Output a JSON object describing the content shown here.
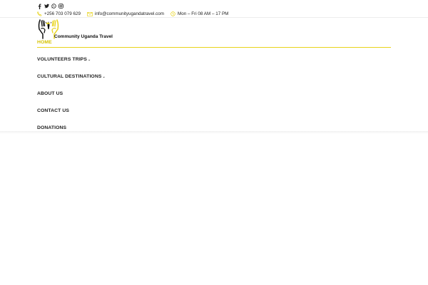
{
  "topbar": {
    "social": [
      "facebook-icon",
      "twitter-icon",
      "whatsapp-icon",
      "instagram-icon"
    ],
    "phone": "+256 703 079 629",
    "email": "info@communityugandatravel.com",
    "hours": "Mon – Fri 08 AM – 17 PM"
  },
  "brand": {
    "name": "Community Uganda Travel"
  },
  "nav": {
    "items": [
      {
        "label": "HOME",
        "has_submenu": false
      },
      {
        "label": "VOLUNTEERS TRIPS",
        "has_submenu": true
      },
      {
        "label": "CULTURAL DESTINATIONS",
        "has_submenu": true
      },
      {
        "label": "ABOUT US",
        "has_submenu": false
      },
      {
        "label": "CONTACT US",
        "has_submenu": false
      },
      {
        "label": "DONATIONS",
        "has_submenu": false
      }
    ],
    "chevron": "⌄"
  },
  "colors": {
    "accent": "#e8d31a",
    "text": "#222222"
  }
}
